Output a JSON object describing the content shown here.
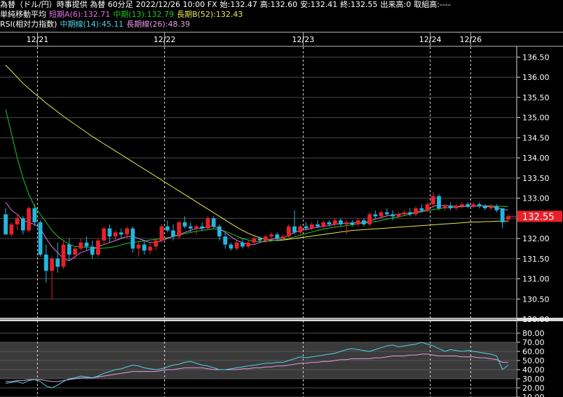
{
  "header": {
    "title": "為替（ドル/円）時事提供 為替 60分足",
    "datetime": "2022/12/26 10:00 FX",
    "open": "始:132.47",
    "high": "高:132.60",
    "low": "安:132.41",
    "close": "終:132.55",
    "volume": "出来高:0",
    "turnover": "取組高:----",
    "ma_label": "単純移動平均",
    "ma_short": "短期A(6):132.71",
    "ma_mid": "中期(13):132.79",
    "ma_long": "長期B(52):132.43",
    "rsi_label": "RSI(相対力指数)",
    "rsi_mid": "中期線(14):45.11",
    "rsi_long": "長期線(26):48.39"
  },
  "colors": {
    "up": "#e8202a",
    "down": "#21b8e0",
    "ma_short": "#e46fe4",
    "ma_mid": "#1ecb1e",
    "ma_long": "#e8e84e",
    "rsi_mid": "#4fd4e8",
    "rsi_long": "#e89ae8",
    "price_tag": "#e8202a"
  },
  "chart_data": [
    {
      "type": "candlestick",
      "x_labels": [
        "12/21",
        "12/22",
        "12/23",
        "12/24",
        "12/26"
      ],
      "ylim": [
        130.0,
        136.75
      ],
      "y_ticks": [
        "136.50",
        "136.00",
        "135.50",
        "135.00",
        "134.50",
        "134.00",
        "133.50",
        "133.00",
        "132.50",
        "132.00",
        "131.50",
        "131.00",
        "130.50",
        "130.00"
      ],
      "current_price": "132.55",
      "candles": [
        {
          "o": 132.6,
          "h": 132.75,
          "l": 132.1,
          "c": 132.1
        },
        {
          "o": 132.1,
          "h": 132.4,
          "l": 132.05,
          "c": 132.35
        },
        {
          "o": 132.35,
          "h": 132.6,
          "l": 132.2,
          "c": 132.5
        },
        {
          "o": 132.5,
          "h": 132.55,
          "l": 132.1,
          "c": 132.2
        },
        {
          "o": 132.2,
          "h": 132.8,
          "l": 132.15,
          "c": 132.75
        },
        {
          "o": 132.75,
          "h": 132.85,
          "l": 132.3,
          "c": 132.4
        },
        {
          "o": 132.4,
          "h": 132.45,
          "l": 131.55,
          "c": 131.6
        },
        {
          "o": 131.6,
          "h": 131.85,
          "l": 130.9,
          "c": 131.2
        },
        {
          "o": 131.2,
          "h": 131.55,
          "l": 130.5,
          "c": 131.5
        },
        {
          "o": 131.5,
          "h": 131.9,
          "l": 131.15,
          "c": 131.3
        },
        {
          "o": 131.3,
          "h": 131.95,
          "l": 131.25,
          "c": 131.85
        },
        {
          "o": 131.85,
          "h": 132.0,
          "l": 131.45,
          "c": 131.6
        },
        {
          "o": 131.6,
          "h": 131.8,
          "l": 131.5,
          "c": 131.75
        },
        {
          "o": 131.75,
          "h": 132.0,
          "l": 131.7,
          "c": 131.9
        },
        {
          "o": 131.9,
          "h": 132.05,
          "l": 131.7,
          "c": 131.8
        },
        {
          "o": 131.8,
          "h": 131.95,
          "l": 131.5,
          "c": 131.6
        },
        {
          "o": 131.6,
          "h": 132.0,
          "l": 131.55,
          "c": 131.95
        },
        {
          "o": 131.95,
          "h": 132.3,
          "l": 131.85,
          "c": 132.25
        },
        {
          "o": 132.25,
          "h": 132.35,
          "l": 131.9,
          "c": 132.05
        },
        {
          "o": 132.05,
          "h": 132.2,
          "l": 131.95,
          "c": 132.15
        },
        {
          "o": 132.15,
          "h": 132.25,
          "l": 132.0,
          "c": 132.1
        },
        {
          "o": 132.1,
          "h": 132.3,
          "l": 132.0,
          "c": 132.25
        },
        {
          "o": 132.25,
          "h": 132.3,
          "l": 131.65,
          "c": 131.75
        },
        {
          "o": 131.75,
          "h": 131.9,
          "l": 131.55,
          "c": 131.85
        },
        {
          "o": 131.85,
          "h": 131.95,
          "l": 131.6,
          "c": 131.7
        },
        {
          "o": 131.7,
          "h": 131.9,
          "l": 131.6,
          "c": 131.8
        },
        {
          "o": 131.8,
          "h": 132.0,
          "l": 131.7,
          "c": 131.95
        },
        {
          "o": 131.95,
          "h": 132.35,
          "l": 131.9,
          "c": 132.3
        },
        {
          "o": 132.3,
          "h": 132.45,
          "l": 132.15,
          "c": 132.2
        },
        {
          "o": 132.2,
          "h": 132.35,
          "l": 131.95,
          "c": 132.05
        },
        {
          "o": 132.05,
          "h": 132.45,
          "l": 132.0,
          "c": 132.4
        },
        {
          "o": 132.4,
          "h": 132.55,
          "l": 132.25,
          "c": 132.3
        },
        {
          "o": 132.3,
          "h": 132.4,
          "l": 132.15,
          "c": 132.25
        },
        {
          "o": 132.25,
          "h": 132.35,
          "l": 132.1,
          "c": 132.3
        },
        {
          "o": 132.3,
          "h": 132.4,
          "l": 132.2,
          "c": 132.25
        },
        {
          "o": 132.25,
          "h": 132.55,
          "l": 132.2,
          "c": 132.5
        },
        {
          "o": 132.5,
          "h": 132.55,
          "l": 132.25,
          "c": 132.3
        },
        {
          "o": 132.3,
          "h": 132.35,
          "l": 131.95,
          "c": 132.05
        },
        {
          "o": 132.05,
          "h": 132.15,
          "l": 131.75,
          "c": 131.85
        },
        {
          "o": 131.85,
          "h": 131.9,
          "l": 131.7,
          "c": 131.75
        },
        {
          "o": 131.75,
          "h": 131.95,
          "l": 131.7,
          "c": 131.9
        },
        {
          "o": 131.9,
          "h": 132.0,
          "l": 131.75,
          "c": 131.8
        },
        {
          "o": 131.8,
          "h": 131.95,
          "l": 131.75,
          "c": 131.9
        },
        {
          "o": 131.9,
          "h": 132.05,
          "l": 131.85,
          "c": 132.0
        },
        {
          "o": 132.0,
          "h": 132.05,
          "l": 131.9,
          "c": 131.95
        },
        {
          "o": 131.95,
          "h": 132.1,
          "l": 131.9,
          "c": 132.05
        },
        {
          "o": 132.05,
          "h": 132.15,
          "l": 131.95,
          "c": 132.1
        },
        {
          "o": 132.1,
          "h": 132.15,
          "l": 131.95,
          "c": 132.0
        },
        {
          "o": 132.0,
          "h": 132.1,
          "l": 131.95,
          "c": 132.05
        },
        {
          "o": 132.05,
          "h": 132.35,
          "l": 132.0,
          "c": 132.3
        },
        {
          "o": 132.3,
          "h": 132.7,
          "l": 132.1,
          "c": 132.15
        },
        {
          "o": 132.15,
          "h": 132.35,
          "l": 132.1,
          "c": 132.3
        },
        {
          "o": 132.3,
          "h": 132.4,
          "l": 132.2,
          "c": 132.25
        },
        {
          "o": 132.25,
          "h": 132.4,
          "l": 132.2,
          "c": 132.35
        },
        {
          "o": 132.35,
          "h": 132.45,
          "l": 132.25,
          "c": 132.3
        },
        {
          "o": 132.3,
          "h": 132.45,
          "l": 132.25,
          "c": 132.4
        },
        {
          "o": 132.4,
          "h": 132.45,
          "l": 132.3,
          "c": 132.35
        },
        {
          "o": 132.35,
          "h": 132.5,
          "l": 132.3,
          "c": 132.45
        },
        {
          "o": 132.45,
          "h": 132.5,
          "l": 132.3,
          "c": 132.35
        },
        {
          "o": 132.35,
          "h": 132.45,
          "l": 132.1,
          "c": 132.4
        },
        {
          "o": 132.4,
          "h": 132.45,
          "l": 132.3,
          "c": 132.35
        },
        {
          "o": 132.35,
          "h": 132.5,
          "l": 132.3,
          "c": 132.45
        },
        {
          "o": 132.45,
          "h": 132.5,
          "l": 132.3,
          "c": 132.35
        },
        {
          "o": 132.35,
          "h": 132.65,
          "l": 132.3,
          "c": 132.6
        },
        {
          "o": 132.6,
          "h": 132.7,
          "l": 132.5,
          "c": 132.55
        },
        {
          "o": 132.55,
          "h": 132.7,
          "l": 132.5,
          "c": 132.65
        },
        {
          "o": 132.65,
          "h": 132.75,
          "l": 132.55,
          "c": 132.6
        },
        {
          "o": 132.6,
          "h": 132.7,
          "l": 132.45,
          "c": 132.55
        },
        {
          "o": 132.55,
          "h": 132.65,
          "l": 132.5,
          "c": 132.6
        },
        {
          "o": 132.6,
          "h": 132.7,
          "l": 132.55,
          "c": 132.65
        },
        {
          "o": 132.65,
          "h": 132.75,
          "l": 132.55,
          "c": 132.6
        },
        {
          "o": 132.6,
          "h": 132.8,
          "l": 132.55,
          "c": 132.75
        },
        {
          "o": 132.75,
          "h": 132.85,
          "l": 132.65,
          "c": 132.7
        },
        {
          "o": 132.7,
          "h": 132.9,
          "l": 132.65,
          "c": 132.85
        },
        {
          "o": 132.85,
          "h": 133.15,
          "l": 132.75,
          "c": 133.05
        },
        {
          "o": 133.05,
          "h": 133.1,
          "l": 132.7,
          "c": 132.75
        },
        {
          "o": 132.75,
          "h": 132.85,
          "l": 132.7,
          "c": 132.8
        },
        {
          "o": 132.8,
          "h": 132.9,
          "l": 132.7,
          "c": 132.75
        },
        {
          "o": 132.75,
          "h": 132.85,
          "l": 132.7,
          "c": 132.8
        },
        {
          "o": 132.8,
          "h": 132.9,
          "l": 132.75,
          "c": 132.85
        },
        {
          "o": 132.85,
          "h": 132.9,
          "l": 132.75,
          "c": 132.8
        },
        {
          "o": 132.8,
          "h": 132.9,
          "l": 132.75,
          "c": 132.85
        },
        {
          "o": 132.85,
          "h": 132.9,
          "l": 132.75,
          "c": 132.8
        },
        {
          "o": 132.8,
          "h": 132.85,
          "l": 132.7,
          "c": 132.75
        },
        {
          "o": 132.75,
          "h": 132.85,
          "l": 132.7,
          "c": 132.8
        },
        {
          "o": 132.8,
          "h": 132.85,
          "l": 132.65,
          "c": 132.7
        },
        {
          "o": 132.75,
          "h": 132.75,
          "l": 132.25,
          "c": 132.4
        },
        {
          "o": 132.47,
          "h": 132.6,
          "l": 132.41,
          "c": 132.55
        }
      ],
      "ma_short": [
        132.9,
        132.7,
        132.6,
        132.45,
        132.4,
        132.35,
        132.25,
        132.0,
        131.8,
        131.65,
        131.5,
        131.45,
        131.55,
        131.65,
        131.7,
        131.75,
        131.8,
        131.85,
        131.9,
        131.95,
        132.0,
        132.05,
        132.05,
        132.0,
        131.95,
        131.9,
        131.9,
        131.95,
        132.0,
        132.05,
        132.1,
        132.15,
        132.2,
        132.25,
        132.25,
        132.3,
        132.3,
        132.25,
        132.15,
        132.05,
        131.95,
        131.9,
        131.85,
        131.85,
        131.9,
        131.95,
        131.98,
        132.0,
        132.02,
        132.08,
        132.15,
        132.2,
        132.22,
        132.25,
        132.28,
        132.3,
        132.32,
        132.35,
        132.37,
        132.38,
        132.38,
        132.4,
        132.4,
        132.43,
        132.48,
        132.52,
        132.56,
        132.58,
        132.6,
        132.62,
        132.63,
        132.66,
        132.68,
        132.72,
        132.8,
        132.82,
        132.82,
        132.81,
        132.8,
        132.8,
        132.8,
        132.8,
        132.81,
        132.8,
        132.79,
        132.77,
        132.72,
        132.71
      ],
      "ma_mid": [
        135.2,
        134.6,
        134.0,
        133.5,
        133.1,
        132.8,
        132.6,
        132.4,
        132.2,
        132.05,
        131.95,
        131.85,
        131.8,
        131.8,
        131.78,
        131.76,
        131.75,
        131.76,
        131.78,
        131.8,
        131.84,
        131.88,
        131.9,
        131.92,
        131.94,
        131.96,
        131.98,
        132.0,
        132.02,
        132.05,
        132.08,
        132.12,
        132.15,
        132.18,
        132.2,
        132.22,
        132.24,
        132.22,
        132.18,
        132.12,
        132.06,
        132.0,
        131.96,
        131.93,
        131.92,
        131.92,
        131.94,
        131.96,
        131.98,
        132.0,
        132.04,
        132.08,
        132.12,
        132.16,
        132.2,
        132.23,
        132.26,
        132.28,
        132.3,
        132.32,
        132.34,
        132.36,
        132.38,
        132.4,
        132.42,
        132.45,
        132.48,
        132.51,
        132.54,
        132.57,
        132.6,
        132.63,
        132.66,
        132.69,
        132.72,
        132.74,
        132.76,
        132.77,
        132.78,
        132.79,
        132.8,
        132.8,
        132.81,
        132.81,
        132.81,
        132.8,
        132.8,
        132.79
      ],
      "ma_long": [
        136.3,
        136.15,
        136.0,
        135.85,
        135.72,
        135.6,
        135.48,
        135.36,
        135.25,
        135.14,
        135.03,
        134.93,
        134.83,
        134.73,
        134.63,
        134.53,
        134.44,
        134.35,
        134.26,
        134.17,
        134.08,
        133.99,
        133.9,
        133.81,
        133.72,
        133.63,
        133.54,
        133.45,
        133.36,
        133.27,
        133.18,
        133.09,
        133.0,
        132.91,
        132.82,
        132.73,
        132.64,
        132.55,
        132.46,
        132.37,
        132.28,
        132.2,
        132.13,
        132.07,
        132.02,
        131.98,
        131.95,
        131.95,
        131.96,
        131.98,
        132.0,
        132.02,
        132.04,
        132.06,
        132.08,
        132.1,
        132.12,
        132.14,
        132.16,
        132.18,
        132.2,
        132.21,
        132.22,
        132.23,
        132.24,
        132.25,
        132.26,
        132.27,
        132.28,
        132.29,
        132.3,
        132.31,
        132.32,
        132.33,
        132.34,
        132.35,
        132.36,
        132.37,
        132.38,
        132.39,
        132.4,
        132.41,
        132.41,
        132.42,
        132.42,
        132.43,
        132.43,
        132.43
      ]
    },
    {
      "type": "line",
      "ylim": [
        10,
        90
      ],
      "y_ticks": [
        "80.00",
        "70.00",
        "60.00",
        "50.00",
        "40.00",
        "30.00",
        "20.00",
        "10.00"
      ],
      "band": [
        30,
        70
      ],
      "series": [
        {
          "values": [
            25,
            26,
            27,
            25,
            28,
            29,
            27,
            22,
            20,
            23,
            27,
            30,
            31,
            33,
            32,
            31,
            33,
            36,
            38,
            40,
            41,
            43,
            45,
            44,
            42,
            41,
            40,
            41,
            43,
            45,
            46,
            48,
            49,
            47,
            45,
            44,
            42,
            40,
            40,
            41,
            42,
            43,
            44,
            45,
            46,
            47,
            47,
            48,
            48,
            50,
            52,
            54,
            53,
            54,
            55,
            56,
            57,
            58,
            60,
            62,
            63,
            62,
            61,
            60,
            62,
            64,
            66,
            67,
            65,
            66,
            67,
            68,
            70,
            68,
            66,
            63,
            60,
            62,
            61,
            60,
            61,
            60,
            59,
            58,
            57,
            55,
            40,
            45
          ]
        },
        {
          "values": [
            27,
            27,
            28,
            28,
            29,
            29,
            29,
            28,
            27,
            27,
            28,
            29,
            30,
            31,
            31,
            31,
            32,
            33,
            34,
            35,
            36,
            37,
            38,
            38,
            38,
            38,
            38,
            39,
            40,
            40,
            41,
            42,
            42,
            42,
            42,
            41,
            40,
            40,
            40,
            40,
            40,
            41,
            41,
            42,
            42,
            43,
            43,
            44,
            44,
            45,
            46,
            47,
            47,
            48,
            48,
            49,
            49,
            50,
            51,
            51,
            52,
            52,
            52,
            52,
            53,
            53,
            54,
            55,
            55,
            55,
            56,
            56,
            57,
            57,
            56,
            55,
            55,
            55,
            55,
            54,
            54,
            54,
            53,
            53,
            52,
            51,
            48,
            48
          ]
        }
      ]
    }
  ]
}
